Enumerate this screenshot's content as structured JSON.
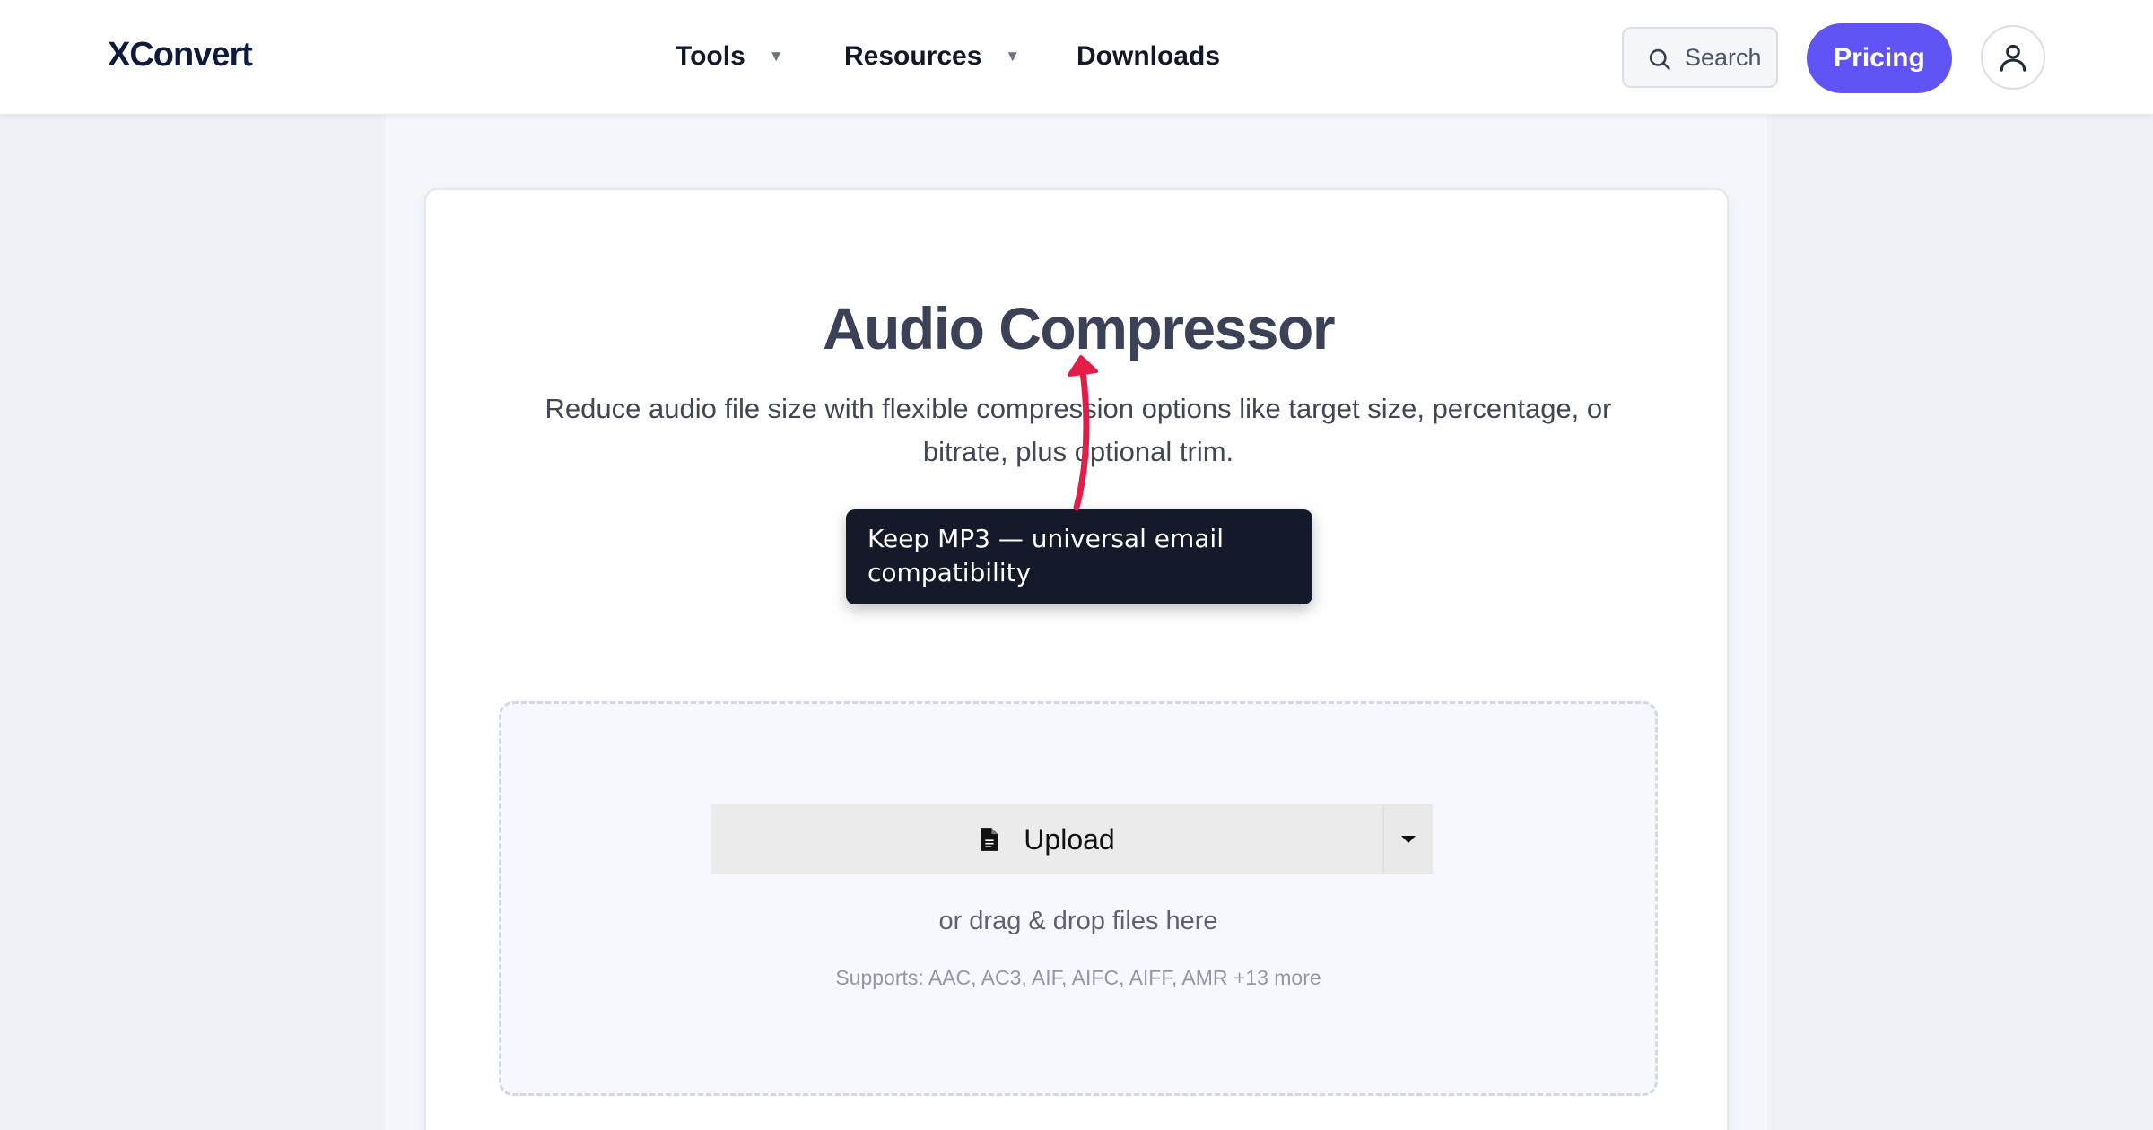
{
  "header": {
    "logo": "XConvert",
    "nav": [
      {
        "label": "Tools",
        "caret": "▼"
      },
      {
        "label": "Resources",
        "caret": "▼"
      },
      {
        "label": "Downloads"
      }
    ],
    "search_label": "Search",
    "pricing_label": "Pricing"
  },
  "main": {
    "title": "Audio Compressor",
    "subtitle": "Reduce audio file size with flexible compression options like target size, percentage, or bitrate, plus optional trim.",
    "tooltip": "Keep MP3 — universal email compatibility",
    "upload": {
      "button_label": "Upload",
      "drag_text": "or drag & drop files here",
      "supports_text": "Supports: AAC, AC3, AIF, AIFC, AIFF, AMR +13 more"
    }
  },
  "colors": {
    "accent": "#6054f5",
    "annotation_arrow": "#e11d48",
    "tooltip_bg": "#141a2a"
  },
  "icons": [
    "search-icon",
    "user-icon",
    "file-icon",
    "caret-down-icon"
  ]
}
